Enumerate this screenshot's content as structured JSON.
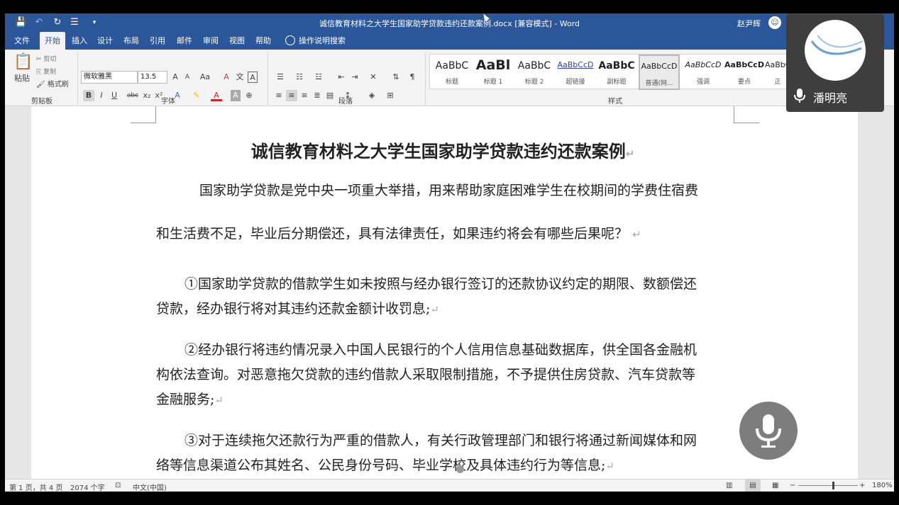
{
  "window": {
    "title": "诚信教育材料之大学生国家助学贷款违约还款案例.docx [兼容模式] - Word",
    "user_name": "赵尹辉",
    "quick_access": [
      "save-icon",
      "undo-icon",
      "redo-icon",
      "list-icon",
      "customize-icon"
    ]
  },
  "tabs": [
    "文件",
    "开始",
    "插入",
    "设计",
    "布局",
    "引用",
    "邮件",
    "审阅",
    "视图",
    "帮助",
    "操作说明搜索"
  ],
  "active_tab": "开始",
  "ribbon": {
    "clipboard": {
      "label": "剪贴板",
      "paste": "粘贴",
      "cut": "剪切",
      "copy": "复制",
      "format_painter": "格式刷"
    },
    "font": {
      "label": "字体",
      "name": "微软雅黑",
      "size": "13.5",
      "bold": "B",
      "italic": "I",
      "underline": "U",
      "strike": "abc"
    },
    "paragraph": {
      "label": "段落"
    },
    "styles": {
      "label": "样式",
      "items": [
        {
          "preview": "AaBbC",
          "name": "标题"
        },
        {
          "preview": "AaBl",
          "name": "标题 1"
        },
        {
          "preview": "AaBbC",
          "name": "标题 2"
        },
        {
          "preview": "AaBbCcD",
          "name": "超链接"
        },
        {
          "preview": "AaBbC",
          "name": "副标题"
        },
        {
          "preview": "AaBbCcD",
          "name": "普通(网..."
        },
        {
          "preview": "AaBbCcD",
          "name": "强调"
        },
        {
          "preview": "AaBbCcD",
          "name": "要点"
        },
        {
          "preview": "AaBbC",
          "name": "正"
        }
      ]
    }
  },
  "document": {
    "heading": "诚信教育材料之大学生国家助学贷款违约还款案例",
    "intro_1": "国家助学贷款是党中央一项重大举措，用来帮助家庭困难学生在校期间的学费住宿费",
    "intro_2": "和生活费不足，毕业后分期偿还，具有法律责任，如果违约将会有哪些后果呢？",
    "p1_1": "①国家助学贷款的借款学生如未按照与经办银行签订的还款协议约定的期限、数额偿还",
    "p1_2": "贷款，经办银行将对其违约还款金额计收罚息;",
    "p2_1": "②经办银行将违约情况录入中国人民银行的个人信用信息基础数据库，供全国各金融机",
    "p2_2": "构依法查询。对恶意拖欠贷款的违约借款人采取限制措施，不予提供住房贷款、汽车贷款等",
    "p2_3": "金融服务;",
    "p3_1": "③对于连续拖欠还款行为严重的借款人，有关行政管理部门和银行将通过新闻媒体和网",
    "p3_2": "络等信息渠道公布其姓名、公民身份号码、毕业学校及具体违约行为等信息;",
    "paragraph_mark": "↵"
  },
  "status": {
    "page": "第 1 页，共 4 页",
    "words": "2074 个字",
    "language": "中文(中国)",
    "zoom": "180%"
  },
  "video_call": {
    "speaker": "潘明亮"
  }
}
